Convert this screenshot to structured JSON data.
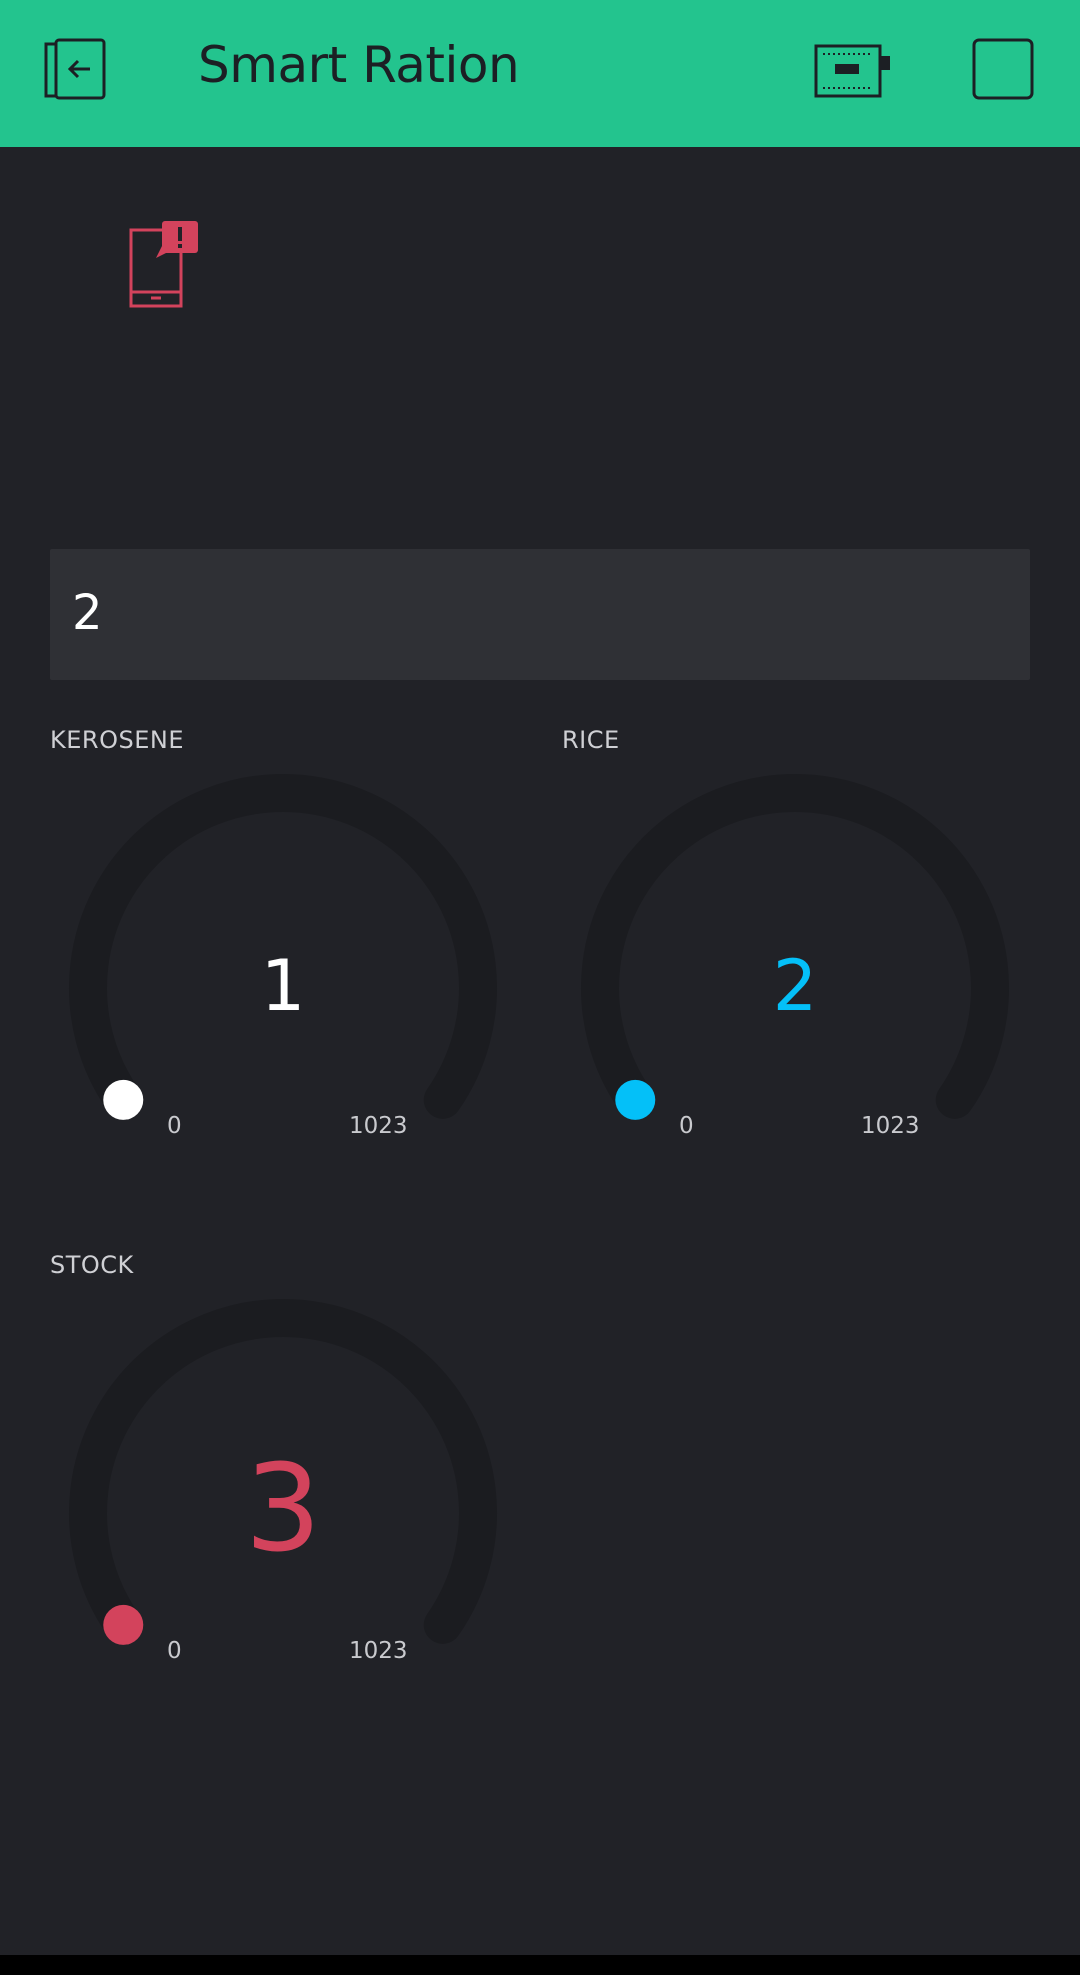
{
  "header": {
    "title": "Smart Ration",
    "back_icon": "exit-project-icon",
    "device_icon": "device-board-icon",
    "play_icon": "stop-square-icon",
    "bg_color": "#23c48e"
  },
  "notification_widget": {
    "icon": "phone-notification-icon",
    "color": "#d3435c"
  },
  "value_display": {
    "value": "2"
  },
  "gauges": [
    {
      "label": "KEROSENE",
      "value": "1",
      "min": "0",
      "max": "1023",
      "color": "#ffffff"
    },
    {
      "label": "RICE",
      "value": "2",
      "min": "0",
      "max": "1023",
      "color": "#04c0f8"
    },
    {
      "label": "STOCK",
      "value": "3",
      "min": "0",
      "max": "1023",
      "color": "#d3435c"
    }
  ]
}
